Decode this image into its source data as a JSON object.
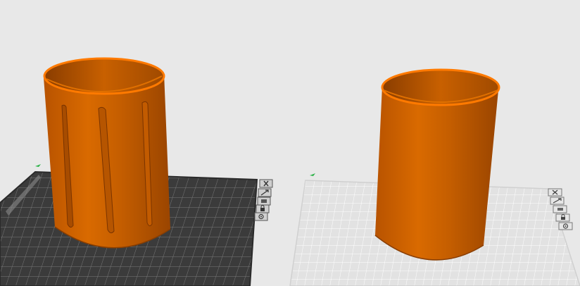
{
  "scene": {
    "background_color": "#e8e8e8",
    "model_color": "#c85f00",
    "model_rim_color": "#ff7a00",
    "dark_plate_color": "#3b3b3b",
    "light_plate_color": "#e4e4e4",
    "plate_marker_color": "#2eb34a"
  },
  "plates": [
    {
      "name": "plate-1",
      "theme": "dark",
      "selected": true,
      "icons": [
        "close-icon",
        "arrange-icon",
        "orient-icon",
        "lock-icon",
        "settings-icon"
      ],
      "model": {
        "shape": "cylinder",
        "features": "vertical-grooves",
        "groove_count": 3
      }
    },
    {
      "name": "plate-2",
      "theme": "light",
      "selected": false,
      "icons": [
        "close-icon",
        "arrange-icon",
        "orient-icon",
        "lock-icon",
        "settings-icon"
      ],
      "model": {
        "shape": "cylinder",
        "features": "smooth"
      }
    }
  ]
}
